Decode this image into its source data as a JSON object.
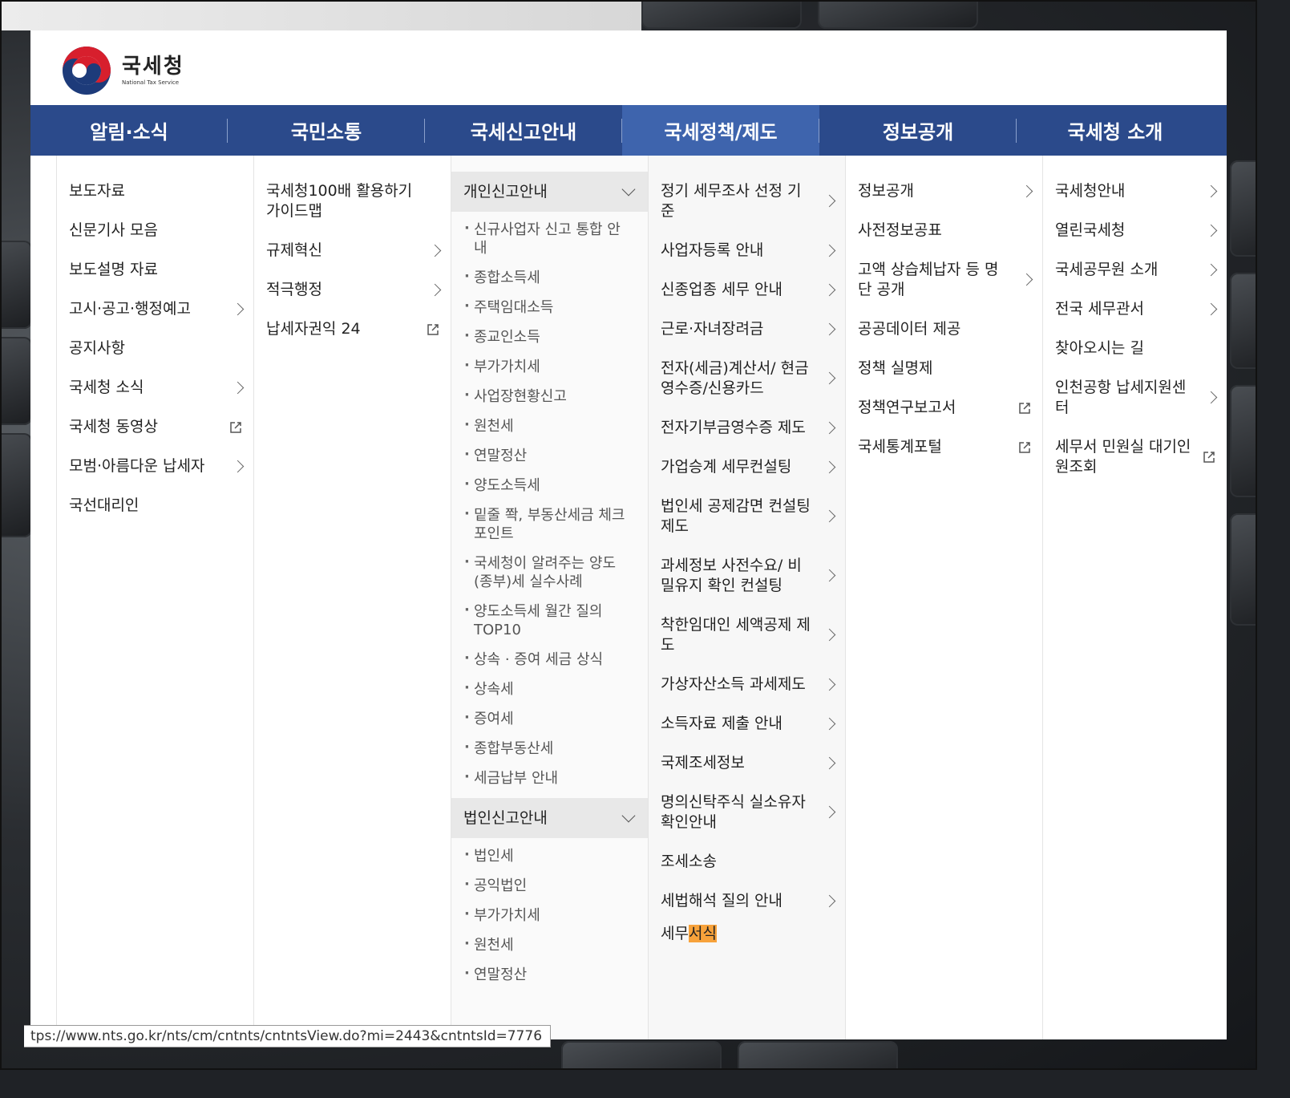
{
  "logo": {
    "name_ko": "국세청",
    "name_en": "National Tax Service"
  },
  "nav": [
    {
      "label": "알림·소식"
    },
    {
      "label": "국민소통"
    },
    {
      "label": "국세신고안내"
    },
    {
      "label": "국세정책/제도",
      "active": true
    },
    {
      "label": "정보공개"
    },
    {
      "label": "국세청 소개"
    }
  ],
  "col1": [
    {
      "label": "보도자료"
    },
    {
      "label": "신문기사 모음"
    },
    {
      "label": "보도설명 자료"
    },
    {
      "label": "고시·공고·행정예고",
      "icon": "chevron-right-icon"
    },
    {
      "label": "공지사항"
    },
    {
      "label": "국세청 소식",
      "icon": "chevron-right-icon"
    },
    {
      "label": "국세청 동영상",
      "icon": "external-link-icon"
    },
    {
      "label": "모범·아름다운 납세자",
      "icon": "chevron-right-icon"
    },
    {
      "label": "국선대리인"
    }
  ],
  "col2": [
    {
      "label": "국세청100배 활용하기 가이드맵"
    },
    {
      "label": "규제혁신",
      "icon": "chevron-right-icon"
    },
    {
      "label": "적극행정",
      "icon": "chevron-right-icon"
    },
    {
      "label": "납세자권익 24",
      "icon": "external-link-icon"
    }
  ],
  "col3": {
    "personal": {
      "title": "개인신고안내",
      "items": [
        "신규사업자 신고 통합 안내",
        "종합소득세",
        "주택임대소득",
        "종교인소득",
        "부가가치세",
        "사업장현황신고",
        "원천세",
        "연말정산",
        "양도소득세",
        "밑줄 쫙, 부동산세금 체크포인트",
        "국세청이 알려주는 양도(종부)세 실수사례",
        "양도소득세 월간 질의 TOP10",
        "상속 · 증여 세금 상식",
        "상속세",
        "증여세",
        "종합부동산세",
        "세금납부 안내"
      ]
    },
    "corporate": {
      "title": "법인신고안내",
      "items": [
        "법인세",
        "공익법인",
        "부가가치세",
        "원천세",
        "연말정산"
      ]
    }
  },
  "col4": [
    {
      "label": "정기 세무조사 선정 기준",
      "icon": "chevron-right-icon"
    },
    {
      "label": "사업자등록 안내",
      "icon": "chevron-right-icon"
    },
    {
      "label": "신종업종 세무 안내",
      "icon": "chevron-right-icon"
    },
    {
      "label": "근로·자녀장려금",
      "icon": "chevron-right-icon"
    },
    {
      "label": "전자(세금)계산서/ 현금영수증/신용카드",
      "icon": "chevron-right-icon"
    },
    {
      "label": "전자기부금영수증 제도",
      "icon": "chevron-right-icon"
    },
    {
      "label": "가업승계 세무컨설팅",
      "icon": "chevron-right-icon"
    },
    {
      "label": "법인세 공제감면 컨설팅 제도",
      "icon": "chevron-right-icon"
    },
    {
      "label": "과세정보 사전수요/ 비밀유지 확인 컨설팅",
      "icon": "chevron-right-icon"
    },
    {
      "label": "착한임대인 세액공제 제도",
      "icon": "chevron-right-icon"
    },
    {
      "label": "가상자산소득 과세제도",
      "icon": "chevron-right-icon"
    },
    {
      "label": "소득자료 제출 안내",
      "icon": "chevron-right-icon"
    },
    {
      "label": "국제조세정보",
      "icon": "chevron-right-icon"
    },
    {
      "label": "명의신탁주식 실소유자 확인안내",
      "icon": "chevron-right-icon"
    },
    {
      "label": "조세소송"
    },
    {
      "label": "세법해석 질의 안내",
      "icon": "chevron-right-icon"
    }
  ],
  "col4_last": {
    "prefix": "세무",
    "highlight": "서식"
  },
  "col5": [
    {
      "label": "정보공개",
      "icon": "chevron-right-icon"
    },
    {
      "label": "사전정보공표"
    },
    {
      "label": "고액 상습체납자 등 명단 공개",
      "icon": "chevron-right-icon"
    },
    {
      "label": "공공데이터 제공"
    },
    {
      "label": "정책 실명제"
    },
    {
      "label": "정책연구보고서",
      "icon": "external-link-icon"
    },
    {
      "label": "국세통계포털",
      "icon": "external-link-icon"
    }
  ],
  "col6": [
    {
      "label": "국세청안내",
      "icon": "chevron-right-icon"
    },
    {
      "label": "열린국세청",
      "icon": "chevron-right-icon"
    },
    {
      "label": "국세공무원 소개",
      "icon": "chevron-right-icon"
    },
    {
      "label": "전국 세무관서",
      "icon": "chevron-right-icon"
    },
    {
      "label": "찾아오시는 길"
    },
    {
      "label": "인천공항 납세지원센터",
      "icon": "chevron-right-icon"
    },
    {
      "label": "세무서 민원실 대기인원조회",
      "icon": "external-link-icon"
    }
  ],
  "status_url": "tps://www.nts.go.kr/nts/cm/cntnts/cntntsView.do?mi=2443&cntntsId=7776",
  "colors": {
    "nav": "#2b4a8b",
    "nav_active": "#3e64ad",
    "highlight": "#f7a23b"
  }
}
